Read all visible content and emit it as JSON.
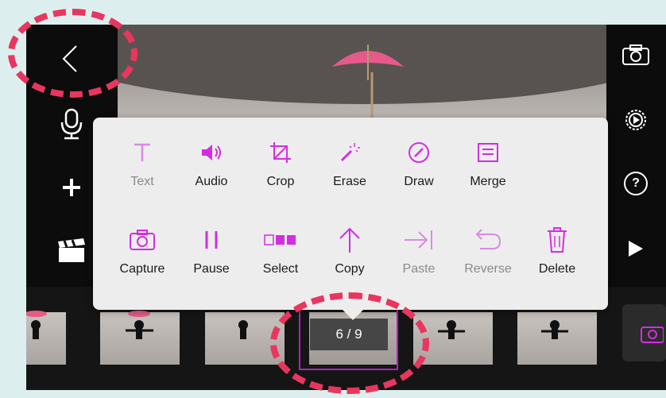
{
  "app": {
    "accent_color": "#d22ee0"
  },
  "left_toolbar": [
    {
      "icon": "chevron-left-icon"
    },
    {
      "icon": "microphone-icon"
    },
    {
      "icon": "plus-icon"
    },
    {
      "icon": "clapperboard-icon"
    }
  ],
  "right_toolbar": [
    {
      "icon": "camera-icon"
    },
    {
      "icon": "settings-gear-icon"
    },
    {
      "icon": "help-icon",
      "label": "?"
    },
    {
      "icon": "play-icon"
    }
  ],
  "menu": {
    "row1": [
      {
        "label": "Text",
        "icon": "text-icon",
        "enabled": false
      },
      {
        "label": "Audio",
        "icon": "speaker-icon",
        "enabled": true
      },
      {
        "label": "Crop",
        "icon": "crop-icon",
        "enabled": true
      },
      {
        "label": "Erase",
        "icon": "magic-wand-icon",
        "enabled": true
      },
      {
        "label": "Draw",
        "icon": "pencil-icon",
        "enabled": true
      },
      {
        "label": "Merge",
        "icon": "merge-icon",
        "enabled": true
      }
    ],
    "row2": [
      {
        "label": "Capture",
        "icon": "camera-icon",
        "enabled": true
      },
      {
        "label": "Pause",
        "icon": "pause-icon",
        "enabled": true
      },
      {
        "label": "Select",
        "icon": "select-frames-icon",
        "enabled": true
      },
      {
        "label": "Copy",
        "icon": "arrow-up-icon",
        "enabled": true
      },
      {
        "label": "Paste",
        "icon": "paste-icon",
        "enabled": false
      },
      {
        "label": "Reverse",
        "icon": "reverse-icon",
        "enabled": false
      },
      {
        "label": "Delete",
        "icon": "trash-icon",
        "enabled": true
      }
    ]
  },
  "filmstrip": {
    "counter": "6 / 9"
  }
}
